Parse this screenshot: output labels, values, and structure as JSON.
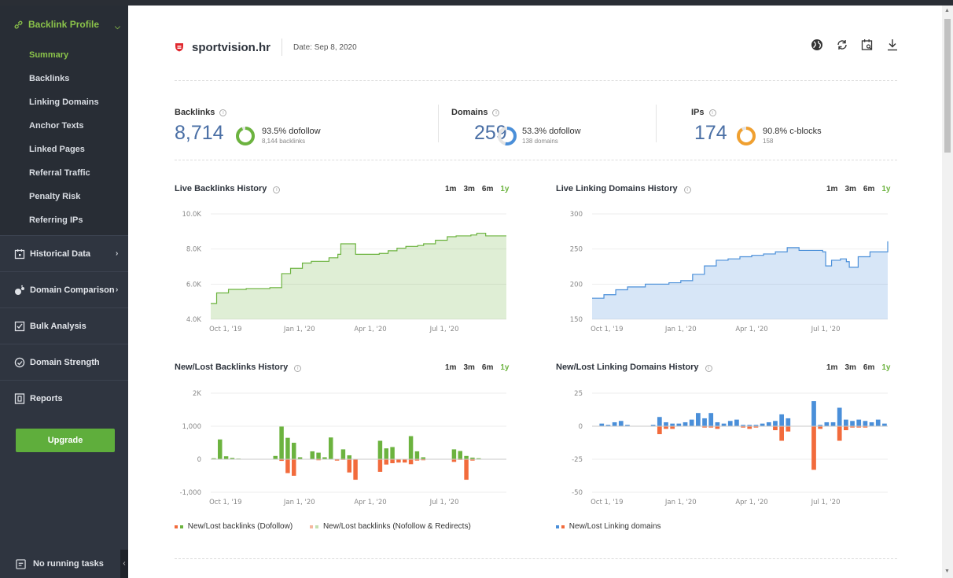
{
  "sidebar": {
    "section_title": "Backlink Profile",
    "sub_items": [
      {
        "label": "Summary",
        "active": true
      },
      {
        "label": "Backlinks"
      },
      {
        "label": "Linking Domains"
      },
      {
        "label": "Anchor Texts"
      },
      {
        "label": "Linked Pages"
      },
      {
        "label": "Referral Traffic"
      },
      {
        "label": "Penalty Risk"
      },
      {
        "label": "Referring IPs"
      }
    ],
    "main_items": [
      {
        "label": "Historical Data",
        "icon": "calendar-icon",
        "has_arrow": true
      },
      {
        "label": "Domain Comparison",
        "icon": "bubbles-icon",
        "has_arrow": true
      },
      {
        "label": "Bulk Analysis",
        "icon": "checklist-icon",
        "has_arrow": false
      },
      {
        "label": "Domain Strength",
        "icon": "gauge-icon",
        "has_arrow": false
      },
      {
        "label": "Reports",
        "icon": "report-icon",
        "has_arrow": false
      }
    ],
    "upgrade_label": "Upgrade",
    "tasks_label": "No running tasks"
  },
  "header": {
    "domain": "sportvision.hr",
    "date": "Date: Sep 8, 2020"
  },
  "stats": {
    "backlinks": {
      "label": "Backlinks",
      "value": "8,714",
      "pct_label": "93.5% dofollow",
      "sub": "8,144 backlinks",
      "fraction": 0.935,
      "color": "#6cb33f"
    },
    "domains": {
      "label": "Domains",
      "value": "259",
      "pct_label": "53.3% dofollow",
      "sub": "138 domains",
      "fraction": 0.533,
      "color": "#4a8fd9"
    },
    "ips": {
      "label": "IPs",
      "value": "174",
      "pct_label": "90.8% c-blocks",
      "sub": "158",
      "fraction": 0.908,
      "color": "#f0a030"
    }
  },
  "ranges": [
    "1m",
    "3m",
    "6m",
    "1y"
  ],
  "active_range": "1y",
  "charts": {
    "live_backlinks": {
      "title": "Live Backlinks History"
    },
    "live_domains": {
      "title": "Live Linking Domains History"
    },
    "newlost_backlinks": {
      "title": "New/Lost Backlinks History",
      "legend": [
        "New/Lost backlinks (Dofollow)",
        "New/Lost backlinks (Nofollow & Redirects)"
      ]
    },
    "newlost_domains": {
      "title": "New/Lost Linking Domains History",
      "legend": [
        "New/Lost Linking domains"
      ]
    }
  },
  "chart_data": [
    {
      "type": "area",
      "title": "Live Backlinks History",
      "x_ticks": [
        "Oct 1, '19",
        "Jan 1, '20",
        "Apr 1, '20",
        "Jul 1, '20"
      ],
      "y_ticks": [
        "4.0K",
        "6.0K",
        "8.0K",
        "10.0K"
      ],
      "ylim": [
        4000,
        10000
      ],
      "x": [
        0,
        0.02,
        0.06,
        0.12,
        0.2,
        0.23,
        0.24,
        0.27,
        0.3,
        0.31,
        0.34,
        0.4,
        0.43,
        0.44,
        0.47,
        0.49,
        0.52,
        0.57,
        0.6,
        0.63,
        0.66,
        0.7,
        0.72,
        0.76,
        0.8,
        0.83,
        0.86,
        0.88,
        0.9,
        0.93,
        0.96,
        1.0
      ],
      "y": [
        4900,
        5500,
        5700,
        5750,
        5800,
        5800,
        6600,
        6900,
        6900,
        7200,
        7300,
        7500,
        7700,
        8300,
        8300,
        7700,
        7700,
        7750,
        7900,
        8050,
        8150,
        8200,
        8300,
        8500,
        8700,
        8750,
        8750,
        8800,
        8900,
        8750,
        8750,
        8750
      ],
      "color": "#6cb33f"
    },
    {
      "type": "area",
      "title": "Live Linking Domains History",
      "x_ticks": [
        "Oct 1, '19",
        "Jan 1, '20",
        "Apr 1, '20",
        "Jul 1, '20"
      ],
      "y_ticks": [
        "150",
        "200",
        "250",
        "300"
      ],
      "ylim": [
        150,
        300
      ],
      "x": [
        0,
        0.04,
        0.08,
        0.12,
        0.18,
        0.22,
        0.26,
        0.3,
        0.34,
        0.38,
        0.42,
        0.46,
        0.5,
        0.54,
        0.58,
        0.62,
        0.66,
        0.7,
        0.74,
        0.78,
        0.79,
        0.81,
        0.84,
        0.86,
        0.87,
        0.9,
        0.94,
        1.0
      ],
      "y": [
        180,
        185,
        192,
        196,
        200,
        200,
        202,
        205,
        214,
        226,
        234,
        236,
        239,
        241,
        243,
        246,
        252,
        248,
        248,
        246,
        226,
        234,
        236,
        232,
        224,
        239,
        246,
        261
      ],
      "color": "#4a8fd9"
    },
    {
      "type": "bar",
      "title": "New/Lost Backlinks History",
      "x_ticks": [
        "Oct 1, '19",
        "Jan 1, '20",
        "Apr 1, '20",
        "Jul 1, '20"
      ],
      "y_ticks": [
        "-1,000",
        "0",
        "1,000",
        "2K"
      ],
      "ylim": [
        -1000,
        2000
      ],
      "series": [
        {
          "name": "New/Lost backlinks (Dofollow)",
          "positive": [
            30,
            600,
            90,
            40,
            20,
            0,
            0,
            0,
            10,
            0,
            100,
            990,
            650,
            500,
            60,
            0,
            240,
            200,
            60,
            660,
            0,
            300,
            120,
            0,
            0,
            0,
            0,
            560,
            330,
            370,
            0,
            0,
            700,
            240,
            60,
            0,
            0,
            0,
            0,
            300,
            250,
            100,
            50,
            30,
            0,
            0,
            0,
            0
          ],
          "negative": [
            0,
            0,
            0,
            0,
            0,
            0,
            0,
            0,
            0,
            0,
            0,
            -50,
            -420,
            -500,
            0,
            0,
            0,
            -30,
            0,
            0,
            -40,
            -20,
            -400,
            -620,
            0,
            0,
            0,
            -380,
            -160,
            -120,
            -100,
            -100,
            -150,
            -40,
            -30,
            0,
            0,
            0,
            -10,
            -80,
            -20,
            -620,
            -40,
            0,
            0,
            0,
            0,
            0
          ]
        },
        {
          "name": "New/Lost backlinks (Nofollow & Redirects)"
        }
      ]
    },
    {
      "type": "bar",
      "title": "New/Lost Linking Domains History",
      "x_ticks": [
        "Oct 1, '19",
        "Jan 1, '20",
        "Apr 1, '20",
        "Jul 1, '20"
      ],
      "y_ticks": [
        "-50",
        "-25",
        "0",
        "25"
      ],
      "ylim": [
        -50,
        25
      ],
      "series": [
        {
          "name": "New/Lost Linking domains",
          "positive": [
            0,
            2,
            1,
            3,
            4,
            1,
            0,
            0,
            0,
            1,
            7,
            3,
            2,
            2,
            3,
            5,
            10,
            6,
            10,
            3,
            2,
            4,
            5,
            1,
            1,
            1,
            2,
            3,
            4,
            9,
            6,
            0,
            0,
            0,
            19,
            1,
            3,
            3,
            14,
            5,
            4,
            5,
            4,
            3,
            5,
            2
          ],
          "negative": [
            0,
            0,
            0,
            0,
            0,
            0,
            0,
            0,
            0,
            0,
            -6,
            -2,
            -2,
            0,
            0,
            0,
            0,
            -1,
            -1,
            -2,
            0,
            0,
            0,
            -1,
            -2,
            -1,
            0,
            0,
            -3,
            -11,
            -4,
            0,
            0,
            0,
            -33,
            -2,
            0,
            0,
            -11,
            -3,
            -1,
            -1,
            -1,
            0,
            0,
            0
          ]
        }
      ]
    }
  ]
}
